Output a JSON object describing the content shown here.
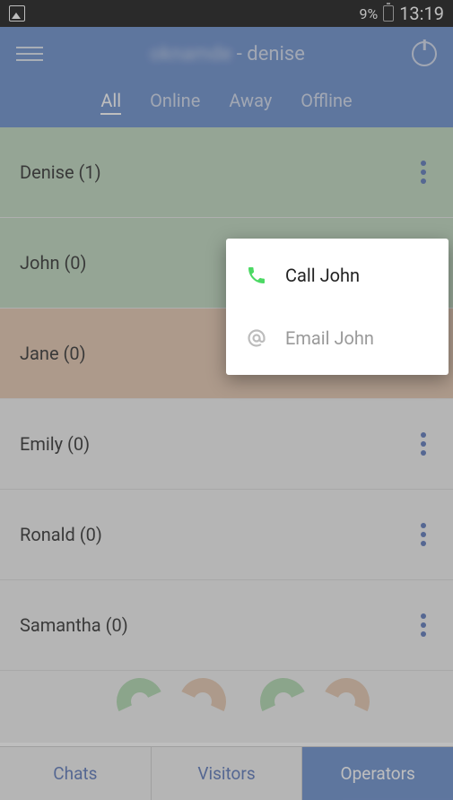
{
  "status": {
    "battery": "9%",
    "time": "13:19"
  },
  "header": {
    "title_blurred": "oknamde",
    "title_suffix": " - denise"
  },
  "filters": [
    {
      "label": "All",
      "active": true
    },
    {
      "label": "Online",
      "active": false
    },
    {
      "label": "Away",
      "active": false
    },
    {
      "label": "Offline",
      "active": false
    }
  ],
  "operators": [
    {
      "name": "Denise (1)",
      "status": "green"
    },
    {
      "name": "John (0)",
      "status": "green"
    },
    {
      "name": "Jane (0)",
      "status": "peach"
    },
    {
      "name": "Emily (0)",
      "status": "grey"
    },
    {
      "name": "Ronald (0)",
      "status": "grey"
    },
    {
      "name": "Samantha (0)",
      "status": "grey"
    }
  ],
  "popover": {
    "call": "Call John",
    "email": "Email John"
  },
  "bottom_nav": {
    "chats": "Chats",
    "visitors": "Visitors",
    "operators": "Operators"
  }
}
